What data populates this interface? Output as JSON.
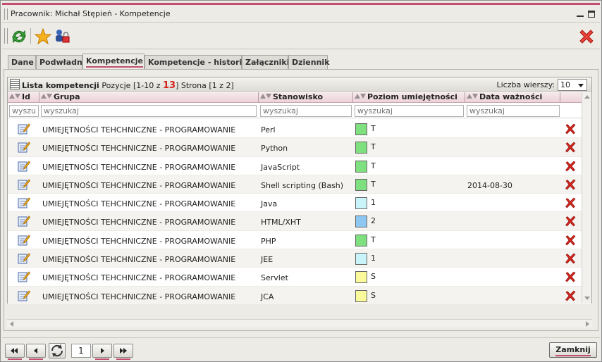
{
  "window": {
    "title": "Pracownik: Michał Stępień - Kompetencje"
  },
  "toolbar": {
    "icons": [
      "refresh-icon",
      "star-icon",
      "user-lock-icon",
      "close-red-icon"
    ]
  },
  "tabs": [
    {
      "label": "Dane",
      "active": false
    },
    {
      "label": "Podwładni",
      "active": false
    },
    {
      "label": "Kompetencje",
      "active": true
    },
    {
      "label": "Kompetencje - historia",
      "active": false
    },
    {
      "label": "Załączniki",
      "active": false
    },
    {
      "label": "Dziennik",
      "active": false
    }
  ],
  "grid": {
    "title": "Lista kompetencji",
    "positions_prefix": "Pozycje [1-10 z",
    "total": "13",
    "page_info": "] Strona [1 z 2]",
    "rows_label": "Liczba wierszy:",
    "rows_value": "10",
    "columns": [
      "Id",
      "Grupa",
      "Stanowisko",
      "Poziom umiejętności",
      "Data ważności"
    ],
    "filter_placeholders": [
      "wyszukaj",
      "wyszukaj",
      "wyszukaj",
      "wyszukaj",
      "wyszukaj"
    ],
    "rows": [
      {
        "group": "UMIEJĘTNOŚCI TEHCHNICZNE - PROGRAMOWANIE",
        "position": "Perl",
        "level": "T",
        "level_color": "#7fe07f",
        "date": ""
      },
      {
        "group": "UMIEJĘTNOŚCI TEHCHNICZNE - PROGRAMOWANIE",
        "position": "Python",
        "level": "T",
        "level_color": "#7fe07f",
        "date": ""
      },
      {
        "group": "UMIEJĘTNOŚCI TEHCHNICZNE - PROGRAMOWANIE",
        "position": "JavaScript",
        "level": "T",
        "level_color": "#7fe07f",
        "date": ""
      },
      {
        "group": "UMIEJĘTNOŚCI TEHCHNICZNE - PROGRAMOWANIE",
        "position": "Shell scripting (Bash)",
        "level": "T",
        "level_color": "#7fe07f",
        "date": "2014-08-30"
      },
      {
        "group": "UMIEJĘTNOŚCI TEHCHNICZNE - PROGRAMOWANIE",
        "position": "Java",
        "level": "1",
        "level_color": "#c8f4fa",
        "date": ""
      },
      {
        "group": "UMIEJĘTNOŚCI TEHCHNICZNE - PROGRAMOWANIE",
        "position": "HTML/XHT",
        "level": "2",
        "level_color": "#8ec8f2",
        "date": ""
      },
      {
        "group": "UMIEJĘTNOŚCI TEHCHNICZNE - PROGRAMOWANIE",
        "position": "PHP",
        "level": "T",
        "level_color": "#7fe07f",
        "date": ""
      },
      {
        "group": "UMIEJĘTNOŚCI TEHCHNICZNE - PROGRAMOWANIE",
        "position": "JEE",
        "level": "1",
        "level_color": "#c8f4fa",
        "date": ""
      },
      {
        "group": "UMIEJĘTNOŚCI TEHCHNICZNE - PROGRAMOWANIE",
        "position": "Servlet",
        "level": "S",
        "level_color": "#fafa9c",
        "date": ""
      },
      {
        "group": "UMIEJĘTNOŚCI TEHCHNICZNE - PROGRAMOWANIE",
        "position": "JCA",
        "level": "S",
        "level_color": "#fafa9c",
        "date": ""
      }
    ]
  },
  "pager": {
    "page": "1"
  },
  "footer": {
    "close_label": "Zamknij"
  },
  "colors": {
    "accent": "#c0506e",
    "delete": "#d2251c"
  }
}
